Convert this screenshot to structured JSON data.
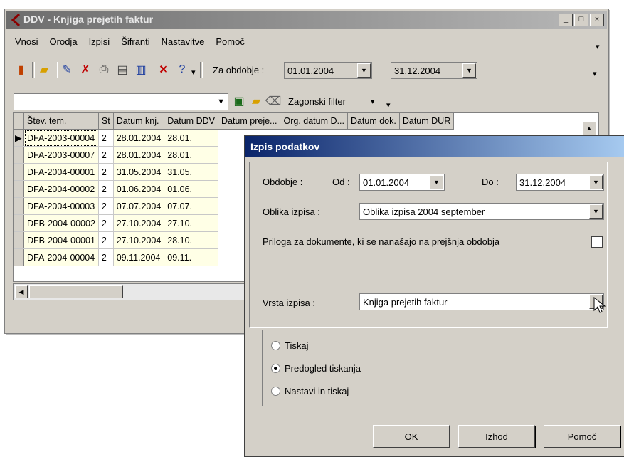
{
  "main_window": {
    "title": "DDV - Knjiga prejetih faktur",
    "controls": [
      "_",
      "□",
      "×"
    ],
    "menu": [
      "Vnosi",
      "Orodja",
      "Izpisi",
      "Šifranti",
      "Nastavitve",
      "Pomoč"
    ],
    "period_label": "Za obdobje :",
    "date_from": "01.01.2004",
    "date_to": "31.12.2004",
    "filter_label": "Zagonski filter",
    "columns": [
      "Štev. tem.",
      "St",
      "Datum knj.",
      "Datum DDV",
      "Datum preje...",
      "Org. datum D...",
      "Datum dok.",
      "Datum DUR"
    ],
    "rows": [
      [
        "DFA-2003-00004",
        "2",
        "28.01.2004",
        "28.01."
      ],
      [
        "DFA-2003-00007",
        "2",
        "28.01.2004",
        "28.01."
      ],
      [
        "DFA-2004-00001",
        "2",
        "31.05.2004",
        "31.05."
      ],
      [
        "DFA-2004-00002",
        "2",
        "01.06.2004",
        "01.06."
      ],
      [
        "DFA-2004-00003",
        "2",
        "07.07.2004",
        "07.07."
      ],
      [
        "DFB-2004-00002",
        "2",
        "27.10.2004",
        "27.10."
      ],
      [
        "DFB-2004-00001",
        "2",
        "27.10.2004",
        "28.10."
      ],
      [
        "DFA-2004-00004",
        "2",
        "09.11.2004",
        "09.11."
      ]
    ]
  },
  "dialog": {
    "title": "Izpis podatkov",
    "obdobje_label": "Obdobje :",
    "od_label": "Od :",
    "od_value": "01.01.2004",
    "do_label": "Do :",
    "do_value": "31.12.2004",
    "oblika_label": "Oblika izpisa :",
    "oblika_value": "Oblika izpisa 2004 september",
    "priloga_label": "Priloga za dokumente, ki se nanašajo na prejšnja obdobja",
    "vrsta_label": "Vrsta izpisa :",
    "vrsta_value": "Knjiga prejetih faktur",
    "radio_options": [
      "Tiskaj",
      "Predogled tiskanja",
      "Nastavi in tiskaj"
    ],
    "selected_option": "Predogled tiskanja",
    "buttons": [
      "OK",
      "Izhod",
      "Pomoč"
    ]
  }
}
